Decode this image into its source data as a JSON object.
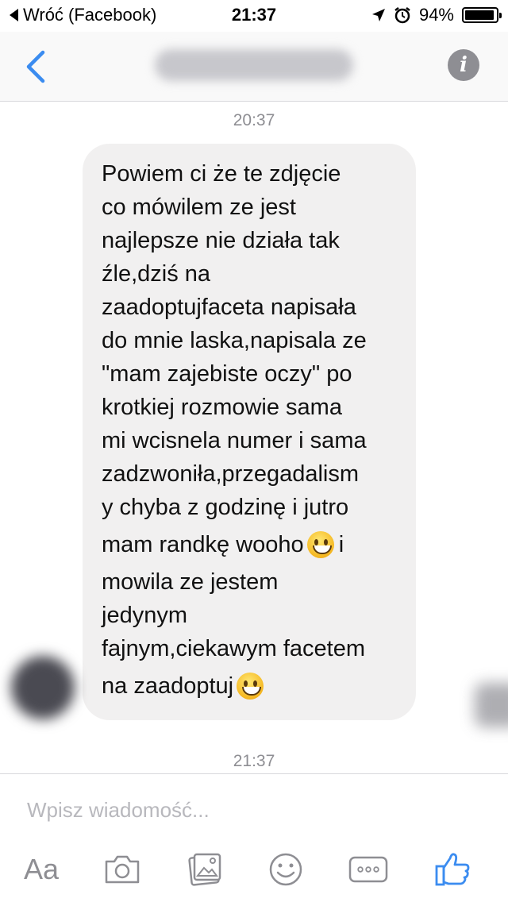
{
  "status_bar": {
    "back_label": "Wróć (Facebook)",
    "time": "21:37",
    "battery": "94%",
    "battery_level": 0.94
  },
  "nav": {
    "back_icon": "chevron-left-icon",
    "info_icon": "info-icon"
  },
  "conversation": {
    "timestamp_top": "20:37",
    "timestamp_bottom": "21:37",
    "message_lines": [
      "Powiem ci że te zdjęcie",
      "co mówilem ze jest",
      "najlepsze nie działa tak",
      "źle,dziś na",
      "zaadoptujfaceta napisała",
      "do mnie laska,napisala ze",
      "\"mam zajebiste oczy\" po",
      "krotkiej rozmowie sama",
      "mi wcisnela numer i sama",
      "zadzwoniła,przegadalism",
      "y chyba z godzinę i jutro",
      "mam randkę wooho",
      " i",
      "mowila ze jestem",
      "jedynym",
      "fajnym,ciekawym facetem",
      "na zaadoptuj"
    ]
  },
  "composer": {
    "placeholder": "Wpisz wiadomość...",
    "aa_label": "Aa"
  },
  "colors": {
    "accent": "#3b8cf0",
    "bubble": "#f1f0f0",
    "icon_gray": "#8e8e93"
  }
}
